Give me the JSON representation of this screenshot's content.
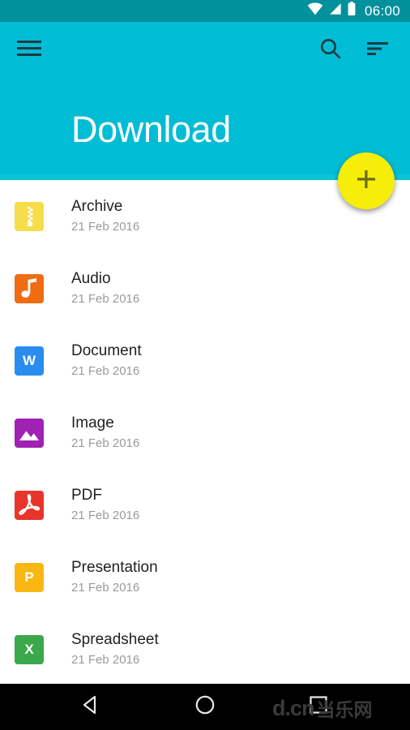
{
  "status_bar": {
    "time": "06:00",
    "icons": [
      "wifi-icon",
      "cellular-signal-icon",
      "battery-icon"
    ],
    "background_color": "#00919c"
  },
  "header": {
    "title": "Download",
    "background_color": "#00bcd4",
    "menu_icon": "hamburger-menu-icon",
    "search_icon": "search-icon",
    "sort_icon": "sort-icon"
  },
  "fab": {
    "icon": "plus-icon",
    "color": "#f5ee08",
    "icon_color": "#6b6b17"
  },
  "list": {
    "items": [
      {
        "title": "Archive",
        "date": "21 Feb 2016",
        "icon": "archive-zip-icon",
        "icon_color": "#f6dd4a",
        "glyph": ""
      },
      {
        "title": "Audio",
        "date": "21 Feb 2016",
        "icon": "audio-music-icon",
        "icon_color": "#ef6c12",
        "glyph": ""
      },
      {
        "title": "Document",
        "date": "21 Feb 2016",
        "icon": "word-document-icon",
        "icon_color": "#2b8cf0",
        "glyph": "W"
      },
      {
        "title": "Image",
        "date": "21 Feb 2016",
        "icon": "image-photo-icon",
        "icon_color": "#a021b4",
        "glyph": ""
      },
      {
        "title": "PDF",
        "date": "21 Feb 2016",
        "icon": "pdf-icon",
        "icon_color": "#e8342a",
        "glyph": ""
      },
      {
        "title": "Presentation",
        "date": "21 Feb 2016",
        "icon": "powerpoint-icon",
        "icon_color": "#f9b713",
        "glyph": "P"
      },
      {
        "title": "Spreadsheet",
        "date": "21 Feb 2016",
        "icon": "excel-icon",
        "icon_color": "#3aa84b",
        "glyph": "X"
      }
    ]
  },
  "nav_bar": {
    "back_icon": "back-triangle-icon",
    "home_icon": "home-circle-icon",
    "recents_icon": "recents-square-icon",
    "background_color": "#000000"
  },
  "watermark": {
    "latin": "d.cn",
    "chinese": "当乐网"
  }
}
